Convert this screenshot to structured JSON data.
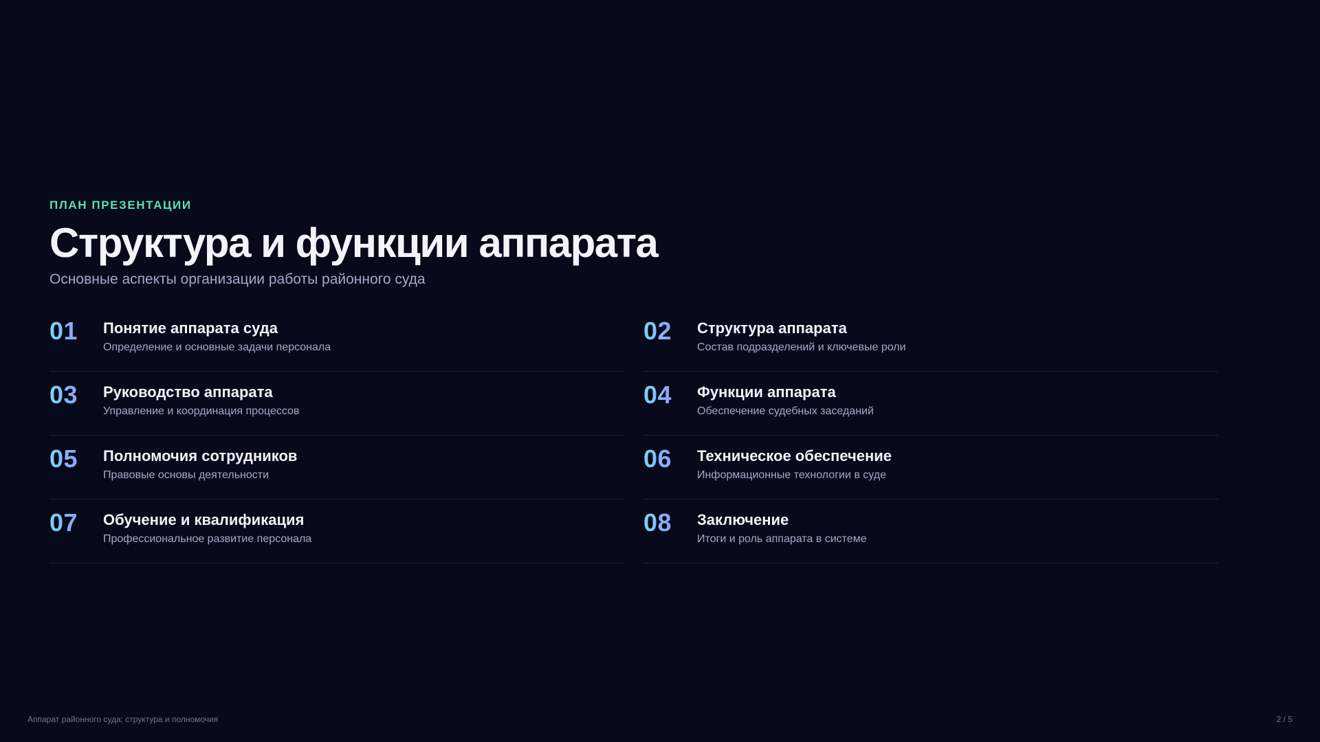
{
  "header": {
    "eyebrow": "ПЛАН ПРЕЗЕНТАЦИИ",
    "title": "Структура и функции аппарата",
    "subtitle": "Основные аспекты организации работы районного суда"
  },
  "agenda": [
    {
      "num": "01",
      "title": "Понятие аппарата суда",
      "desc": "Определение и основные задачи персонала"
    },
    {
      "num": "02",
      "title": "Структура аппарата",
      "desc": "Состав подразделений и ключевые роли"
    },
    {
      "num": "03",
      "title": "Руководство аппарата",
      "desc": "Управление и координация процессов"
    },
    {
      "num": "04",
      "title": "Функции аппарата",
      "desc": "Обеспечение судебных заседаний"
    },
    {
      "num": "05",
      "title": "Полномочия сотрудников",
      "desc": "Правовые основы деятельности"
    },
    {
      "num": "06",
      "title": "Техническое обеспечение",
      "desc": "Информационные технологии в суде"
    },
    {
      "num": "07",
      "title": "Обучение и квалификация",
      "desc": "Профессиональное развитие персонала"
    },
    {
      "num": "08",
      "title": "Заключение",
      "desc": "Итоги и роль аппарата в системе"
    }
  ],
  "footer": {
    "left": "Аппарат районного суда: структура и полномочия",
    "page": "2 / 5"
  },
  "colors": {
    "background": "#070a1b",
    "accent": "#5ee0b5",
    "number_gradient_start": "#7cd6f3",
    "number_gradient_end": "#a58cf5"
  }
}
